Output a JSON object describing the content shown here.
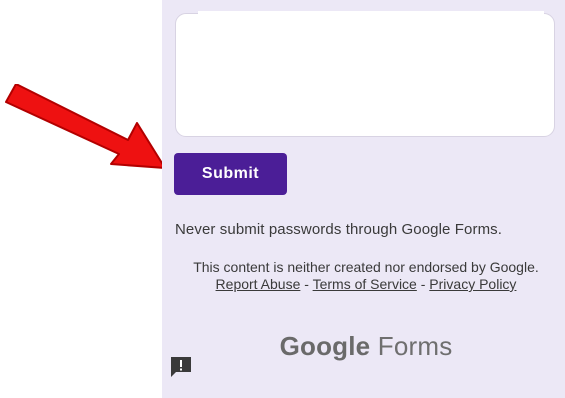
{
  "form": {
    "submit_label": "Submit",
    "password_warning": "Never submit passwords through Google Forms.",
    "disclaimer_prefix": "This content is neither created nor endorsed by Google. ",
    "report_abuse_label": "Report Abuse",
    "separator_1": " - ",
    "terms_label": "Terms of Service",
    "separator_2": " - ",
    "privacy_label": "Privacy Policy",
    "brand_google": "Google",
    "brand_forms": " Forms"
  },
  "colors": {
    "panel_background": "#ece8f6",
    "submit_button": "#4b1e97",
    "arrow": "#ee1111"
  },
  "icons": {
    "annotation_arrow": "arrow-icon",
    "feedback": "feedback-icon"
  }
}
